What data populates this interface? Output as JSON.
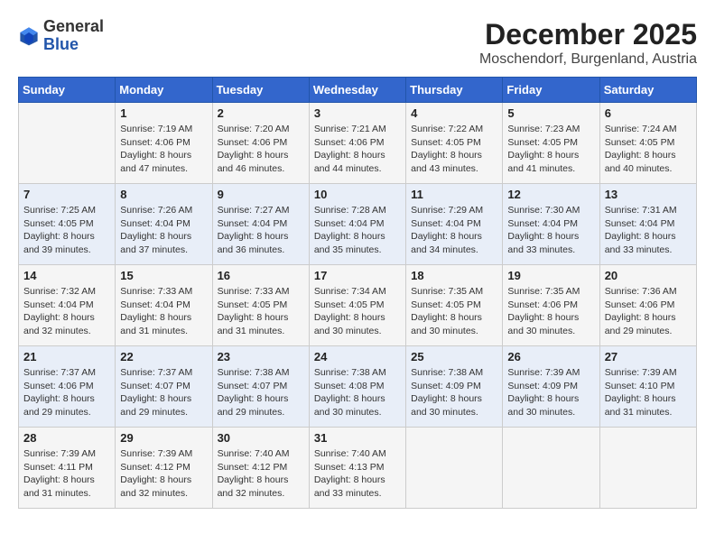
{
  "header": {
    "logo_general": "General",
    "logo_blue": "Blue",
    "month_title": "December 2025",
    "location": "Moschendorf, Burgenland, Austria"
  },
  "days_of_week": [
    "Sunday",
    "Monday",
    "Tuesday",
    "Wednesday",
    "Thursday",
    "Friday",
    "Saturday"
  ],
  "weeks": [
    [
      {
        "day": "",
        "info": ""
      },
      {
        "day": "1",
        "info": "Sunrise: 7:19 AM\nSunset: 4:06 PM\nDaylight: 8 hours\nand 47 minutes."
      },
      {
        "day": "2",
        "info": "Sunrise: 7:20 AM\nSunset: 4:06 PM\nDaylight: 8 hours\nand 46 minutes."
      },
      {
        "day": "3",
        "info": "Sunrise: 7:21 AM\nSunset: 4:06 PM\nDaylight: 8 hours\nand 44 minutes."
      },
      {
        "day": "4",
        "info": "Sunrise: 7:22 AM\nSunset: 4:05 PM\nDaylight: 8 hours\nand 43 minutes."
      },
      {
        "day": "5",
        "info": "Sunrise: 7:23 AM\nSunset: 4:05 PM\nDaylight: 8 hours\nand 41 minutes."
      },
      {
        "day": "6",
        "info": "Sunrise: 7:24 AM\nSunset: 4:05 PM\nDaylight: 8 hours\nand 40 minutes."
      }
    ],
    [
      {
        "day": "7",
        "info": "Sunrise: 7:25 AM\nSunset: 4:05 PM\nDaylight: 8 hours\nand 39 minutes."
      },
      {
        "day": "8",
        "info": "Sunrise: 7:26 AM\nSunset: 4:04 PM\nDaylight: 8 hours\nand 37 minutes."
      },
      {
        "day": "9",
        "info": "Sunrise: 7:27 AM\nSunset: 4:04 PM\nDaylight: 8 hours\nand 36 minutes."
      },
      {
        "day": "10",
        "info": "Sunrise: 7:28 AM\nSunset: 4:04 PM\nDaylight: 8 hours\nand 35 minutes."
      },
      {
        "day": "11",
        "info": "Sunrise: 7:29 AM\nSunset: 4:04 PM\nDaylight: 8 hours\nand 34 minutes."
      },
      {
        "day": "12",
        "info": "Sunrise: 7:30 AM\nSunset: 4:04 PM\nDaylight: 8 hours\nand 33 minutes."
      },
      {
        "day": "13",
        "info": "Sunrise: 7:31 AM\nSunset: 4:04 PM\nDaylight: 8 hours\nand 33 minutes."
      }
    ],
    [
      {
        "day": "14",
        "info": "Sunrise: 7:32 AM\nSunset: 4:04 PM\nDaylight: 8 hours\nand 32 minutes."
      },
      {
        "day": "15",
        "info": "Sunrise: 7:33 AM\nSunset: 4:04 PM\nDaylight: 8 hours\nand 31 minutes."
      },
      {
        "day": "16",
        "info": "Sunrise: 7:33 AM\nSunset: 4:05 PM\nDaylight: 8 hours\nand 31 minutes."
      },
      {
        "day": "17",
        "info": "Sunrise: 7:34 AM\nSunset: 4:05 PM\nDaylight: 8 hours\nand 30 minutes."
      },
      {
        "day": "18",
        "info": "Sunrise: 7:35 AM\nSunset: 4:05 PM\nDaylight: 8 hours\nand 30 minutes."
      },
      {
        "day": "19",
        "info": "Sunrise: 7:35 AM\nSunset: 4:06 PM\nDaylight: 8 hours\nand 30 minutes."
      },
      {
        "day": "20",
        "info": "Sunrise: 7:36 AM\nSunset: 4:06 PM\nDaylight: 8 hours\nand 29 minutes."
      }
    ],
    [
      {
        "day": "21",
        "info": "Sunrise: 7:37 AM\nSunset: 4:06 PM\nDaylight: 8 hours\nand 29 minutes."
      },
      {
        "day": "22",
        "info": "Sunrise: 7:37 AM\nSunset: 4:07 PM\nDaylight: 8 hours\nand 29 minutes."
      },
      {
        "day": "23",
        "info": "Sunrise: 7:38 AM\nSunset: 4:07 PM\nDaylight: 8 hours\nand 29 minutes."
      },
      {
        "day": "24",
        "info": "Sunrise: 7:38 AM\nSunset: 4:08 PM\nDaylight: 8 hours\nand 30 minutes."
      },
      {
        "day": "25",
        "info": "Sunrise: 7:38 AM\nSunset: 4:09 PM\nDaylight: 8 hours\nand 30 minutes."
      },
      {
        "day": "26",
        "info": "Sunrise: 7:39 AM\nSunset: 4:09 PM\nDaylight: 8 hours\nand 30 minutes."
      },
      {
        "day": "27",
        "info": "Sunrise: 7:39 AM\nSunset: 4:10 PM\nDaylight: 8 hours\nand 31 minutes."
      }
    ],
    [
      {
        "day": "28",
        "info": "Sunrise: 7:39 AM\nSunset: 4:11 PM\nDaylight: 8 hours\nand 31 minutes."
      },
      {
        "day": "29",
        "info": "Sunrise: 7:39 AM\nSunset: 4:12 PM\nDaylight: 8 hours\nand 32 minutes."
      },
      {
        "day": "30",
        "info": "Sunrise: 7:40 AM\nSunset: 4:12 PM\nDaylight: 8 hours\nand 32 minutes."
      },
      {
        "day": "31",
        "info": "Sunrise: 7:40 AM\nSunset: 4:13 PM\nDaylight: 8 hours\nand 33 minutes."
      },
      {
        "day": "",
        "info": ""
      },
      {
        "day": "",
        "info": ""
      },
      {
        "day": "",
        "info": ""
      }
    ]
  ]
}
